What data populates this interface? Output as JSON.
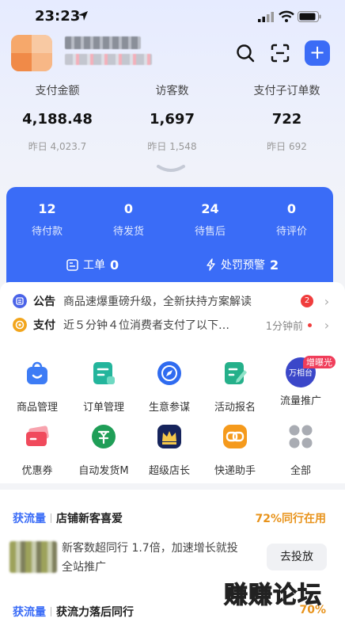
{
  "status_bar": {
    "time": "23:23"
  },
  "stats": [
    {
      "label": "支付金额",
      "value": "4,188.48",
      "yesterday": "昨日 4,023.7"
    },
    {
      "label": "访客数",
      "value": "1,697",
      "yesterday": "昨日 1,548"
    },
    {
      "label": "支付子订单数",
      "value": "722",
      "yesterday": "昨日 692"
    }
  ],
  "header": {
    "plus_label": "+"
  },
  "orders": [
    {
      "count": "12",
      "label": "待付款"
    },
    {
      "count": "0",
      "label": "待发货"
    },
    {
      "count": "24",
      "label": "待售后"
    },
    {
      "count": "0",
      "label": "待评价"
    }
  ],
  "order_sub": {
    "ticket_label": "工单",
    "ticket_count": "0",
    "penalty_label": "处罚预警",
    "penalty_count": "2"
  },
  "notices": [
    {
      "tag": "公告",
      "text": "商品速爆重磅升级，全新扶持方案解读",
      "badge": "2",
      "color": "#4a63e8"
    },
    {
      "tag": "支付",
      "text": "近５分钟４位消费者支付了以下…",
      "ago": "1分钟前",
      "color": "#f2a51c"
    }
  ],
  "grid": [
    {
      "label": "商品管理",
      "icon": "shopping-bag-icon",
      "color": "#3d7cf5"
    },
    {
      "label": "订单管理",
      "icon": "order-doc-icon",
      "color": "#23b59c"
    },
    {
      "label": "生意参谋",
      "icon": "compass-icon",
      "color": "#2f6bf0"
    },
    {
      "label": "活动报名",
      "icon": "edit-doc-icon",
      "color": "#25b08a"
    },
    {
      "label": "流量推广",
      "icon": "wanxiangtai-icon",
      "color": "#3b47c9",
      "badge": "增曝光",
      "logo_text": "万相台"
    },
    {
      "label": "优惠券",
      "icon": "coupon-icon",
      "color": "#f04a5c"
    },
    {
      "label": "自动发货M",
      "icon": "auto-ship-icon",
      "color": "#1f9e57"
    },
    {
      "label": "超级店长",
      "icon": "crown-icon",
      "color": "#16245c"
    },
    {
      "label": "快递助手",
      "icon": "express-link-icon",
      "color": "#f59a1c"
    },
    {
      "label": "全部",
      "icon": "all-grid-icon",
      "color": "#a9acb3"
    }
  ],
  "recommendations": [
    {
      "kind": "获流量",
      "title": "店铺新客喜爱",
      "pct": "72%同行在用",
      "desc_line1": "新客数超同行 1.7倍，加速增长就投",
      "desc_line2": "全站推广",
      "button": "去投放"
    },
    {
      "kind": "获流量",
      "title": "获流力落后同行",
      "pct": "70%"
    }
  ],
  "watermark": "赚赚论坛"
}
